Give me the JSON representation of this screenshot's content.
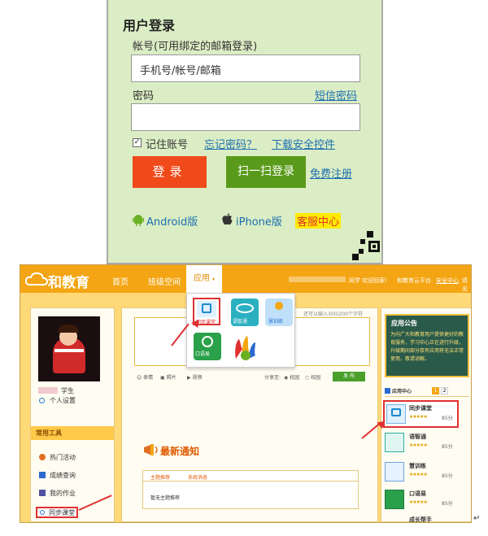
{
  "login": {
    "title": "用户登录",
    "account_label": "帐号(可用绑定的邮箱登录)",
    "account_placeholder": "手机号/帐号/邮箱",
    "password_label": "密码",
    "sms_password_link": "短信密码",
    "remember_label": "记住账号",
    "forgot_link": "忘记密码？",
    "download_link": "下载安全控件",
    "login_button": "登录",
    "scan_button": "扫一扫登录",
    "register_link": "免费注册",
    "android_label": "Android版",
    "iphone_label": "iPhone版",
    "service_label": "客服中心"
  },
  "portal": {
    "logo": "和教育",
    "nav": [
      "首页",
      "班级空间",
      "应用"
    ],
    "nav_right": [
      "同学 欢迎回家!",
      "和教育云平台",
      "安全中心",
      "退出"
    ],
    "apps_dropdown": [
      "同步课堂",
      "语智通",
      "慧训练",
      "口语易",
      ""
    ],
    "post_hint": "还可以输入300/200个字符",
    "post_tools": [
      "表情",
      "照片",
      "视频"
    ],
    "share_label": "分享至:",
    "share_opts": [
      "校园",
      "校园"
    ],
    "publish_button": "发 布",
    "user_role": "学生",
    "personal_settings": "个人设置",
    "tools_head": "常用工具",
    "tools": [
      "热门活动",
      "成绩查询",
      "我的作业",
      "同步课堂"
    ],
    "notice_title": "最新通知",
    "notice_tabs": [
      "主题推荐",
      "系统消息"
    ],
    "notice_empty": "暂无主题推荐",
    "announce_head": "应用公告",
    "announce_text": "为向广大和教育用户提供更好的教育服务，学习中心正在进行升级，升级期间部分厚有应用将无法正常使用，敬请谅解。",
    "app_center_head": "应用中心",
    "app_center_pages": [
      "1",
      "2"
    ],
    "app_list": [
      {
        "name": "同步课堂",
        "stars": "★★★★★",
        "score": "85分"
      },
      {
        "name": "语智通",
        "stars": "★★★★★",
        "score": "85分"
      },
      {
        "name": "慧训练",
        "stars": "★★★★★",
        "score": "85分"
      },
      {
        "name": "口语易",
        "stars": "★★★★★",
        "score": "85分"
      },
      {
        "name": "成长帮手",
        "stars": "",
        "score": ""
      }
    ],
    "colors": {
      "accent": "#f3a513",
      "highlight": "#e03030",
      "green": "#5a9a1a"
    }
  }
}
